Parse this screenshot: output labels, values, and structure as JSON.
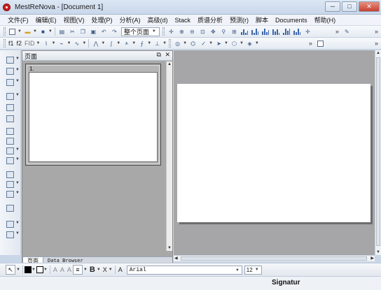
{
  "window": {
    "title": "MestReNova - [Document 1]",
    "buttons": {
      "minimize": "─",
      "maximize": "□",
      "close": "✕"
    }
  },
  "menu": [
    "文件(F)",
    "编辑(E)",
    "视图(V)",
    "处理(P)",
    "分析(A)",
    "高级(d)",
    "Stack",
    "质谱分析",
    "预测(r)",
    "脚本",
    "Documents",
    "帮助(H)"
  ],
  "toolbar1": {
    "zoom_value": "整个页面",
    "more": "»"
  },
  "toolbar2": {
    "f1": "f1",
    "f2": "f2",
    "fid": "FID",
    "more": "»"
  },
  "panel": {
    "title": "页面",
    "thumb_number": "1.",
    "tabs": [
      "页面",
      "Data Browser"
    ],
    "controls": {
      "float": "⧉",
      "close": "✕"
    }
  },
  "format_bar": {
    "bold": "B",
    "subscript": "X",
    "font_label": "A",
    "font_name": "Arial",
    "font_size": "12"
  },
  "status": {
    "signature": "Signatur"
  }
}
